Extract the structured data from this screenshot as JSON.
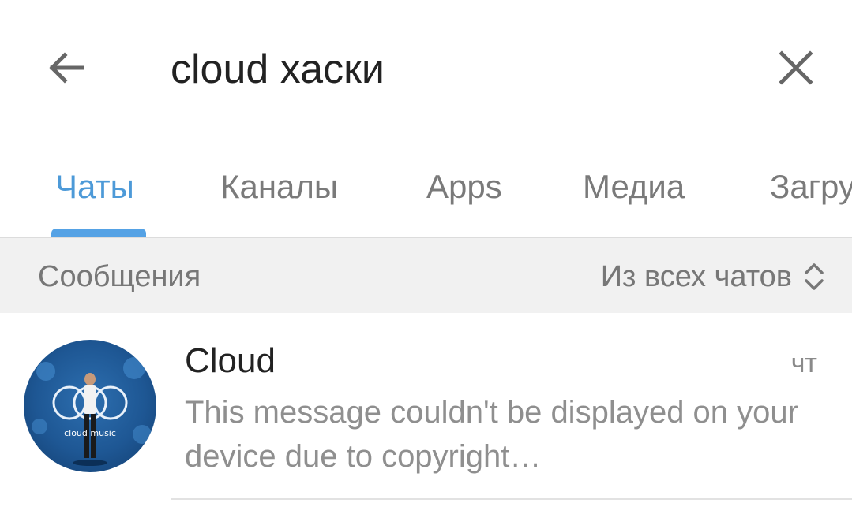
{
  "search": {
    "query": "cloud хаски",
    "back_icon": "arrow-left-icon",
    "clear_icon": "close-icon"
  },
  "tabs": [
    {
      "label": "Чаты",
      "active": true
    },
    {
      "label": "Каналы",
      "active": false
    },
    {
      "label": "Apps",
      "active": false
    },
    {
      "label": "Медиа",
      "active": false
    },
    {
      "label": "Загрузки",
      "active": false
    }
  ],
  "section": {
    "title": "Сообщения",
    "filter_label": "Из всех чатов",
    "filter_icon": "chevron-up-down-icon"
  },
  "results": [
    {
      "name": "Cloud",
      "time": "чт",
      "preview": "This message couldn't be displayed on your device due to copyright…",
      "avatar_text": "cloud music"
    }
  ],
  "colors": {
    "accent": "#4d9ad8",
    "indicator": "#55a2e5",
    "section_bg": "#f1f1f1"
  }
}
